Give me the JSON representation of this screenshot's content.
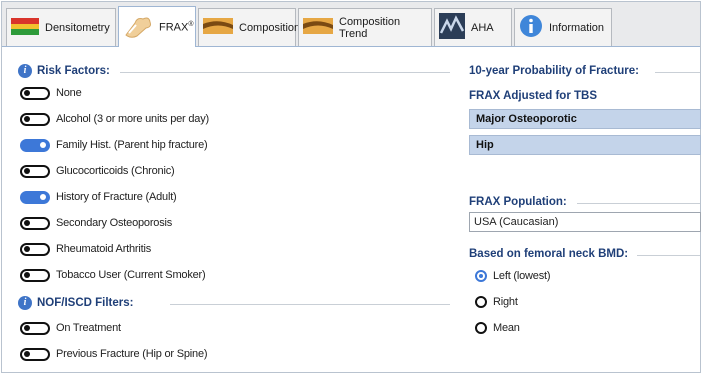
{
  "tabs": [
    {
      "label": "Densitometry",
      "icon": "densitometry-flag-icon"
    },
    {
      "label": "FRAX",
      "sup": "®",
      "icon": "frax-bone-icon",
      "active": true
    },
    {
      "label": "Composition",
      "icon": "composition-icon"
    },
    {
      "label": "Composition Trend",
      "icon": "composition-trend-icon"
    },
    {
      "label": "AHA",
      "icon": "aha-chart-icon"
    },
    {
      "label": "Information",
      "icon": "info-icon"
    }
  ],
  "risk_factors": {
    "title": "Risk Factors:",
    "items": [
      {
        "label": "None",
        "on": false
      },
      {
        "label": "Alcohol (3 or more units per day)",
        "on": false
      },
      {
        "label": "Family Hist. (Parent hip fracture)",
        "on": true
      },
      {
        "label": "Glucocorticoids (Chronic)",
        "on": false
      },
      {
        "label": "History of Fracture (Adult)",
        "on": true
      },
      {
        "label": "Secondary Osteoporosis",
        "on": false
      },
      {
        "label": "Rheumatoid Arthritis",
        "on": false
      },
      {
        "label": "Tobacco User (Current Smoker)",
        "on": false
      }
    ]
  },
  "nof_filters": {
    "title": "NOF/ISCD Filters:",
    "items": [
      {
        "label": "On Treatment",
        "on": false
      },
      {
        "label": "Previous Fracture (Hip or Spine)",
        "on": false
      }
    ]
  },
  "probability": {
    "title": "10-year Probability of Fracture:",
    "subtitle": "FRAX Adjusted for TBS",
    "rows": [
      "Major Osteoporotic",
      "Hip"
    ]
  },
  "population": {
    "title": "FRAX Population:",
    "selected": "USA (Caucasian)"
  },
  "femoral": {
    "title": "Based on femoral neck BMD:",
    "options": [
      {
        "label": "Left (lowest)",
        "selected": true
      },
      {
        "label": "Right",
        "selected": false
      },
      {
        "label": "Mean",
        "selected": false
      }
    ]
  },
  "colors": {
    "accent": "#3d78d8",
    "heading": "#1f3f78",
    "row_bar": "#c4d4ea"
  }
}
